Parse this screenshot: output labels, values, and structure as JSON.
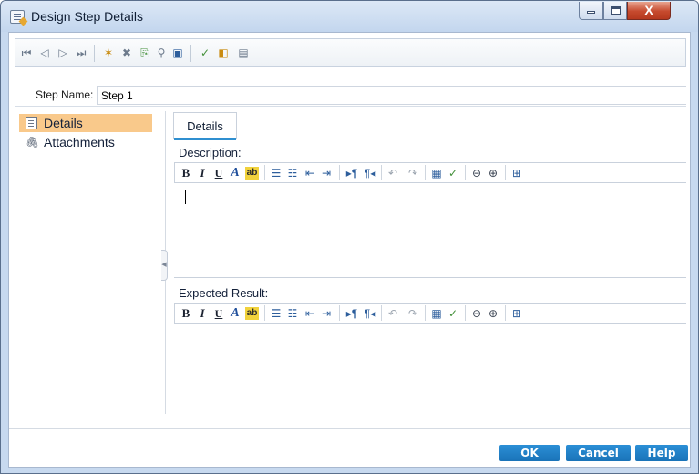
{
  "window": {
    "title": "Design Step Details",
    "controls": {
      "minimize_icon": "minimize-icon",
      "maximize_icon": "maximize-icon",
      "close_glyph": "X"
    }
  },
  "nav_toolbar": {
    "icons": [
      "first-record-icon",
      "previous-record-icon",
      "next-record-icon",
      "last-record-icon",
      "new-step-icon",
      "delete-icon",
      "copy-step-icon",
      "find-icon",
      "save-icon",
      "spell-check-icon",
      "thesaurus-icon",
      "spelling-options-icon"
    ]
  },
  "step_name": {
    "label": "Step Name:",
    "value": "Step 1"
  },
  "sidebar": {
    "items": [
      {
        "label": "Details",
        "icon": "details-icon",
        "selected": true
      },
      {
        "label": "Attachments",
        "icon": "paperclip-icon",
        "selected": false
      }
    ]
  },
  "tabs": [
    {
      "label": "Details",
      "active": true
    }
  ],
  "description": {
    "label": "Description:",
    "value": ""
  },
  "expected_result": {
    "label": "Expected Result:",
    "value": ""
  },
  "editor_toolbar": {
    "bold": "B",
    "italic": "I",
    "underline": "U",
    "font_color": "A",
    "highlight": "ab",
    "icons": [
      "bullet-list-icon",
      "numbered-list-icon",
      "decrease-indent-icon",
      "increase-indent-icon",
      "left-to-right-icon",
      "right-to-left-icon",
      "undo-icon",
      "redo-icon",
      "insert-table-icon",
      "spell-check-icon",
      "zoom-out-icon",
      "zoom-in-icon",
      "clear-formatting-icon"
    ]
  },
  "footer": {
    "ok_label": "OK",
    "cancel_label": "Cancel",
    "help_label": "Help"
  },
  "colors": {
    "accent": "#1a73b8",
    "selection": "#f9c98b",
    "tab_underline": "#2f8fd0",
    "close_button": "#c64a2e"
  }
}
